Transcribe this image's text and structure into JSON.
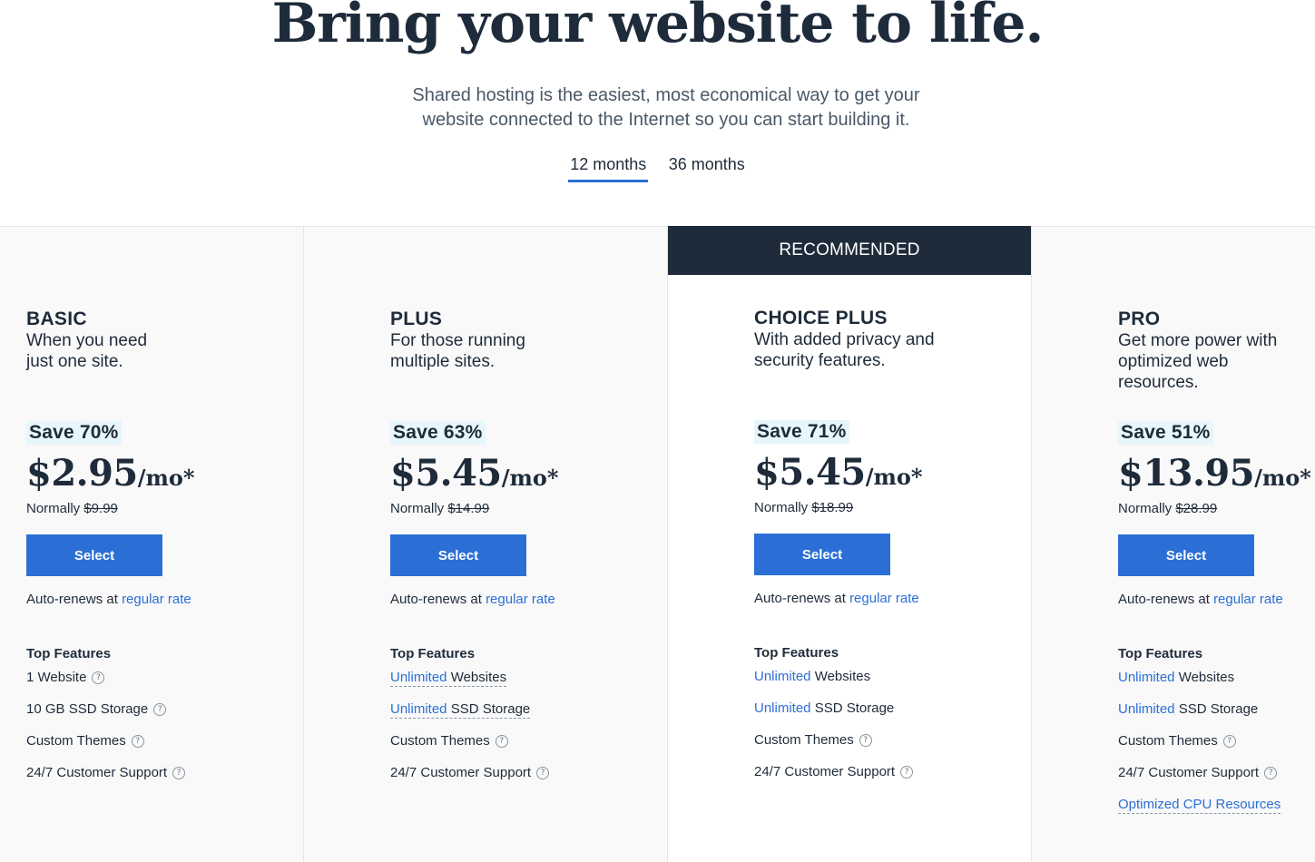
{
  "hero": {
    "title": "Bring your website to life.",
    "subtitle_line1": "Shared hosting is the easiest, most economical way to get your",
    "subtitle_line2": "website connected to the Internet so you can start building it."
  },
  "term_tabs": [
    {
      "label": "12 months",
      "active": true
    },
    {
      "label": "36 months",
      "active": false
    }
  ],
  "recommended_label": "RECOMMENDED",
  "colors": {
    "accent": "#2b6fd6",
    "dark": "#1e2b3a",
    "save_bg": "#e6f6fa"
  },
  "plans": [
    {
      "name": "BASIC",
      "desc": "When you need just one site.",
      "save": "Save 70%",
      "price": "$2.95",
      "per": "/mo*",
      "normally_label": "Normally",
      "normally_price": "$9.99",
      "select_label": "Select",
      "renew_text": "Auto-renews at",
      "renew_link": "regular rate",
      "features_title": "Top Features",
      "features": [
        {
          "link": "",
          "text": "1 Website",
          "help": true
        },
        {
          "link": "",
          "text": "10 GB SSD Storage",
          "help": true
        },
        {
          "link": "",
          "text": "Custom Themes",
          "help": true
        },
        {
          "link": "",
          "text": "24/7 Customer Support",
          "help": true
        }
      ]
    },
    {
      "name": "PLUS",
      "desc": "For those running multiple sites.",
      "save": "Save 63%",
      "price": "$5.45",
      "per": "/mo*",
      "normally_label": "Normally",
      "normally_price": "$14.99",
      "select_label": "Select",
      "renew_text": "Auto-renews at",
      "renew_link": "regular rate",
      "features_title": "Top Features",
      "features": [
        {
          "link": "Unlimited",
          "text": "Websites",
          "help": false,
          "dashed": true
        },
        {
          "link": "Unlimited",
          "text": "SSD Storage",
          "help": false,
          "dashed": true
        },
        {
          "link": "",
          "text": "Custom Themes",
          "help": true
        },
        {
          "link": "",
          "text": "24/7 Customer Support",
          "help": true
        }
      ]
    },
    {
      "name": "CHOICE PLUS",
      "desc": "With added privacy and security features.",
      "save": "Save 71%",
      "price": "$5.45",
      "per": "/mo*",
      "normally_label": "Normally",
      "normally_price": "$18.99",
      "select_label": "Select",
      "renew_text": "Auto-renews at",
      "renew_link": "regular rate",
      "features_title": "Top Features",
      "features": [
        {
          "link": "Unlimited",
          "text": "Websites",
          "help": false
        },
        {
          "link": "Unlimited",
          "text": "SSD Storage",
          "help": false
        },
        {
          "link": "",
          "text": "Custom Themes",
          "help": true
        },
        {
          "link": "",
          "text": "24/7 Customer Support",
          "help": true
        }
      ]
    },
    {
      "name": "PRO",
      "desc": "Get more power with optimized web resources.",
      "save": "Save 51%",
      "price": "$13.95",
      "per": "/mo*",
      "normally_label": "Normally",
      "normally_price": "$28.99",
      "select_label": "Select",
      "renew_text": "Auto-renews at",
      "renew_link": "regular rate",
      "features_title": "Top Features",
      "features": [
        {
          "link": "Unlimited",
          "text": "Websites",
          "help": false
        },
        {
          "link": "Unlimited",
          "text": "SSD Storage",
          "help": false
        },
        {
          "link": "",
          "text": "Custom Themes",
          "help": true
        },
        {
          "link": "",
          "text": "24/7 Customer Support",
          "help": true
        },
        {
          "link": "Optimized CPU Resources",
          "text": "",
          "help": false,
          "full_link": true
        }
      ]
    }
  ]
}
